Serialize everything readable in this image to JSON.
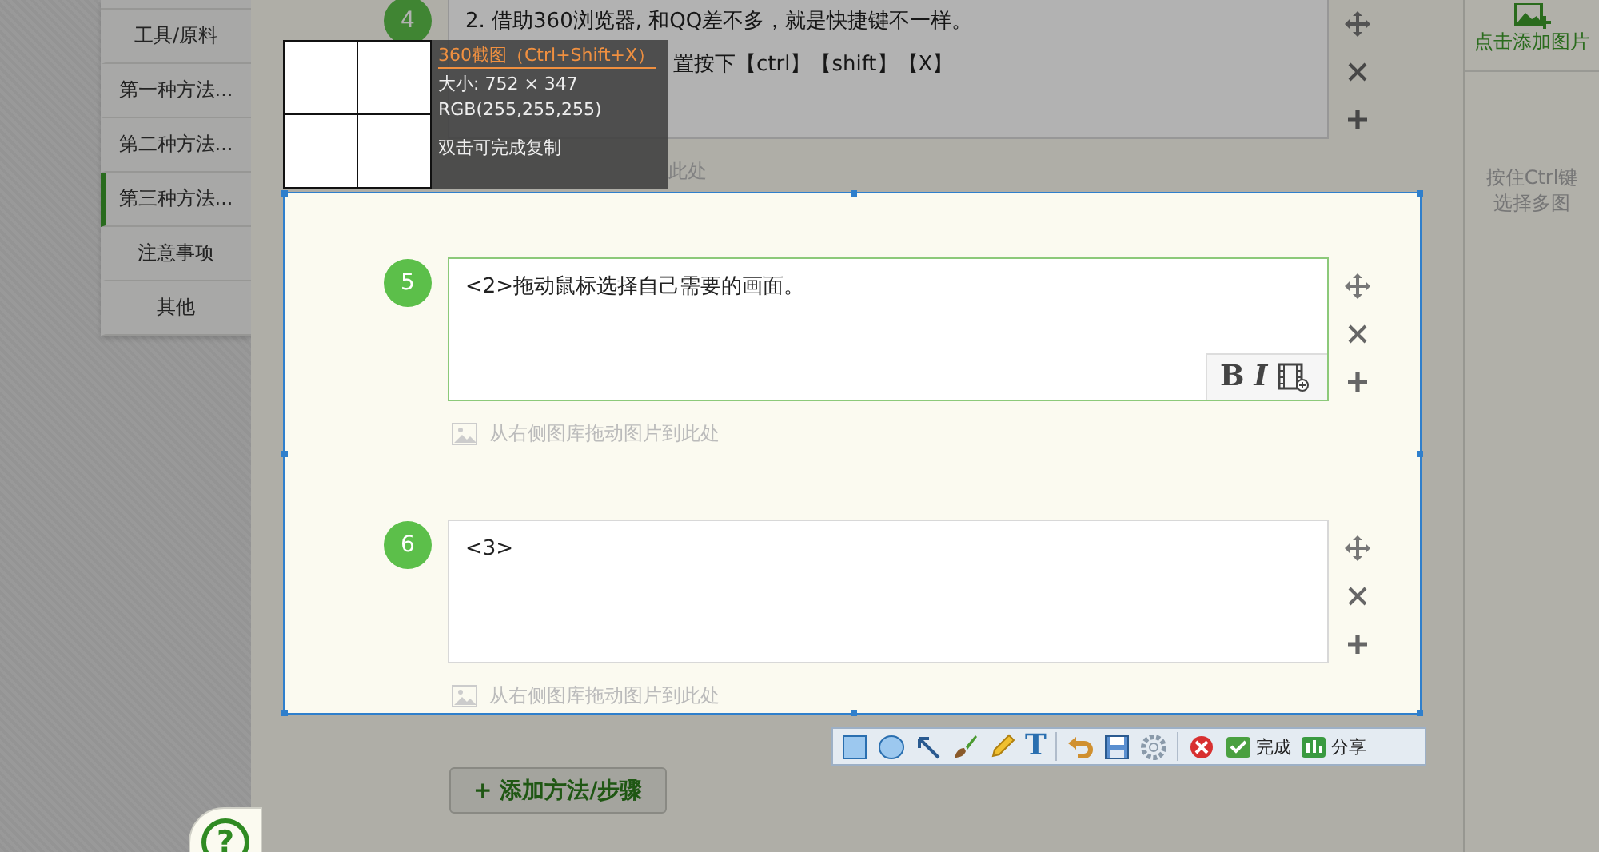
{
  "sidebar": {
    "items": [
      {
        "label": "工具/原料",
        "selected": false
      },
      {
        "label": "第一种方法...",
        "selected": false
      },
      {
        "label": "第二种方法...",
        "selected": false
      },
      {
        "label": "第三种方法...",
        "selected": true
      },
      {
        "label": "注意事项",
        "selected": false
      },
      {
        "label": "其他",
        "selected": false
      }
    ]
  },
  "steps": [
    {
      "number": "4",
      "lines": [
        "2. 借助360浏览器, 和QQ差不多，就是快捷键不一样。",
        "置按下【ctrl】【shift】【X】"
      ],
      "drop_hint": "此处",
      "focused": false
    },
    {
      "number": "5",
      "lines": [
        "<2>拖动鼠标选择自己需要的画面。"
      ],
      "drop_hint": "从右侧图库拖动图片到此处",
      "focused": true,
      "format_buttons": [
        "B",
        "I"
      ]
    },
    {
      "number": "6",
      "lines": [
        "<3>"
      ],
      "drop_hint": "从右侧图库拖动图片到此处",
      "focused": false
    }
  ],
  "add_step_button": "+ 添加方法/步骤",
  "help_button": "?",
  "image_panel": {
    "add_label": "点击添加图片",
    "hint_lines": [
      "按住Ctrl键",
      "选择多图"
    ]
  },
  "capture": {
    "title": "360截图（Ctrl+Shift+X）",
    "size": "大小: 752 × 347",
    "rgb": "RGB(255,255,255)",
    "hint": "双击可完成复制",
    "toolbar": {
      "text_tool": "T",
      "done": "完成",
      "share": "分享"
    }
  }
}
